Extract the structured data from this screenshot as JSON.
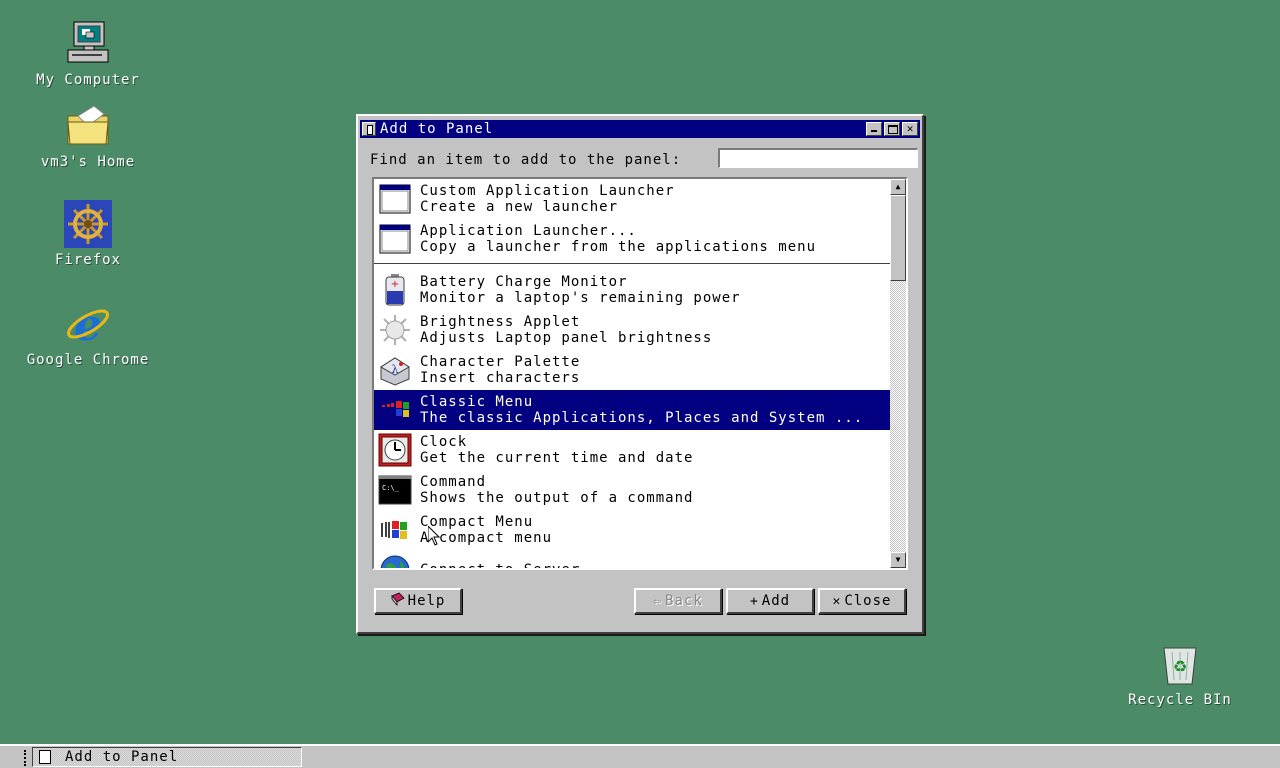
{
  "desktop": {
    "icons": [
      {
        "label": "My Computer",
        "icon": "computer-icon"
      },
      {
        "label": "vm3's Home",
        "icon": "folder-icon"
      },
      {
        "label": "Firefox",
        "icon": "ship-wheel-icon"
      },
      {
        "label": "Google Chrome",
        "icon": "ie-icon"
      },
      {
        "label": "Recycle BIn",
        "icon": "recycle-bin-icon"
      }
    ]
  },
  "window": {
    "title": "Add to Panel",
    "find_label": "Find an item to add to the panel:",
    "find_value": "",
    "items": [
      {
        "title": "Custom Application Launcher",
        "desc": "Create a new launcher",
        "icon": "window-icon"
      },
      {
        "title": "Application Launcher...",
        "desc": "Copy a launcher from the applications menu",
        "icon": "window-icon"
      },
      {
        "title": "Battery Charge Monitor",
        "desc": "Monitor a laptop's remaining power",
        "icon": "battery-icon"
      },
      {
        "title": "Brightness Applet",
        "desc": "Adjusts Laptop panel brightness",
        "icon": "sun-icon"
      },
      {
        "title": "Character Palette",
        "desc": "Insert characters",
        "icon": "character-palette-icon"
      },
      {
        "title": "Classic Menu",
        "desc": "The classic Applications, Places and System ...",
        "icon": "windows-flag-icon",
        "selected": true
      },
      {
        "title": "Clock",
        "desc": "Get the current time and date",
        "icon": "clock-icon"
      },
      {
        "title": "Command",
        "desc": "Shows the output of a command",
        "icon": "terminal-icon"
      },
      {
        "title": "Compact Menu",
        "desc": "A compact menu",
        "icon": "windows-flag-icon"
      },
      {
        "title": "Connect to Server...",
        "desc": "",
        "icon": "globe-icon"
      }
    ],
    "buttons": {
      "help": "Help",
      "back": "Back",
      "add": "Add",
      "close": "Close"
    }
  },
  "taskbar": {
    "task_label": "Add to Panel"
  },
  "colors": {
    "desktop": "#4b8b68",
    "titlebar": "#020080",
    "selection": "#020080",
    "chrome": "#c3c3c3"
  }
}
